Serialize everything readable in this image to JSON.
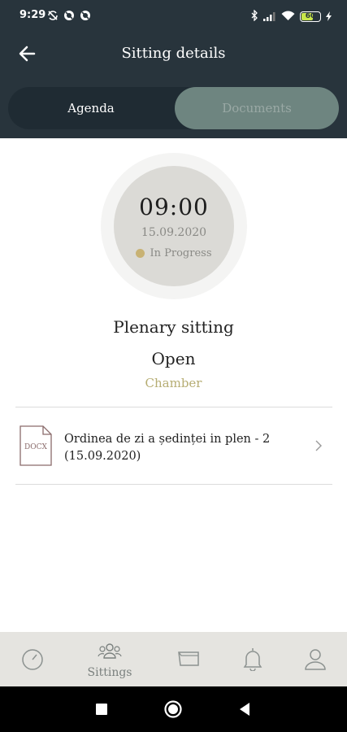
{
  "status_bar": {
    "time": "9:29",
    "battery_level": "60",
    "icons_left": [
      "sync-off-icon",
      "no-disturb-icon",
      "no-disturb-icon"
    ],
    "icons_right": [
      "bluetooth-icon",
      "signal-icon",
      "wifi-icon",
      "battery-icon",
      "charging-icon"
    ]
  },
  "header": {
    "title": "Sitting details",
    "back_icon": "arrow-left-icon"
  },
  "tabs": [
    {
      "label": "Agenda",
      "active": true
    },
    {
      "label": "Documents",
      "active": false
    }
  ],
  "sitting": {
    "time": "09:00",
    "date": "15.09.2020",
    "status": "In Progress",
    "status_color": "#c8b274",
    "name": "Plenary sitting",
    "state": "Open",
    "location": "Chamber"
  },
  "documents": [
    {
      "type_label": "DOCX",
      "title": "Ordinea de zi a ședinței in plen - 2 (15.09.2020)"
    }
  ],
  "bottom_nav": {
    "items": [
      {
        "icon": "gauge-icon",
        "label": ""
      },
      {
        "icon": "users-icon",
        "label": "Sittings",
        "active": true
      },
      {
        "icon": "folder-icon",
        "label": ""
      },
      {
        "icon": "bell-icon",
        "label": ""
      },
      {
        "icon": "user-icon",
        "label": ""
      }
    ]
  },
  "colors": {
    "header_bg": "#28343c",
    "accent_gold": "#b6ad73",
    "tab_inactive_bg": "#6e8580"
  }
}
